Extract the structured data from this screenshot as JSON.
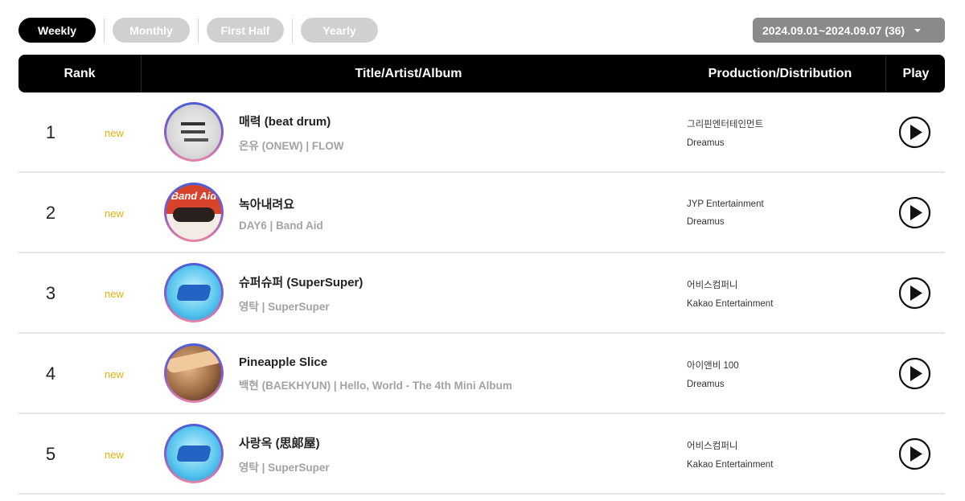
{
  "tabs": [
    {
      "label": "Weekly",
      "active": true
    },
    {
      "label": "Monthly",
      "active": false
    },
    {
      "label": "First Half",
      "active": false
    },
    {
      "label": "Yearly",
      "active": false
    }
  ],
  "date_select": {
    "value": "2024.09.01~2024.09.07 (36)",
    "icon": "caret-down-icon"
  },
  "table": {
    "headers": {
      "rank": "Rank",
      "title": "Title/Artist/Album",
      "production": "Production/Distribution",
      "play": "Play"
    },
    "rows": [
      {
        "rank": "1",
        "badge": "new",
        "title": "매력 (beat drum)",
        "artist_album": "온유 (ONEW) | FLOW",
        "production": "그리핀엔터테인먼트",
        "distribution": "Dreamus"
      },
      {
        "rank": "2",
        "badge": "new",
        "title": "녹아내려요",
        "artist_album": "DAY6 | Band Aid",
        "production": "JYP Entertainment",
        "distribution": "Dreamus",
        "cover_text": "Band Aid"
      },
      {
        "rank": "3",
        "badge": "new",
        "title": "슈퍼슈퍼 (SuperSuper)",
        "artist_album": "영탁 | SuperSuper",
        "production": "어비스컴퍼니",
        "distribution": "Kakao Entertainment"
      },
      {
        "rank": "4",
        "badge": "new",
        "title": "Pineapple Slice",
        "artist_album": "백현 (BAEKHYUN) | Hello, World - The 4th Mini Album",
        "production": "아이앤비 100",
        "distribution": "Dreamus"
      },
      {
        "rank": "5",
        "badge": "new",
        "title": "사랑옥 (思郞屋)",
        "artist_album": "영탁 | SuperSuper",
        "production": "어비스컴퍼니",
        "distribution": "Kakao Entertainment"
      }
    ]
  },
  "colors": {
    "accent_new": "#e3b00c",
    "header_bg": "#000000",
    "inactive_tab": "#d0d0d0",
    "date_select_bg": "#8a8a8a"
  }
}
